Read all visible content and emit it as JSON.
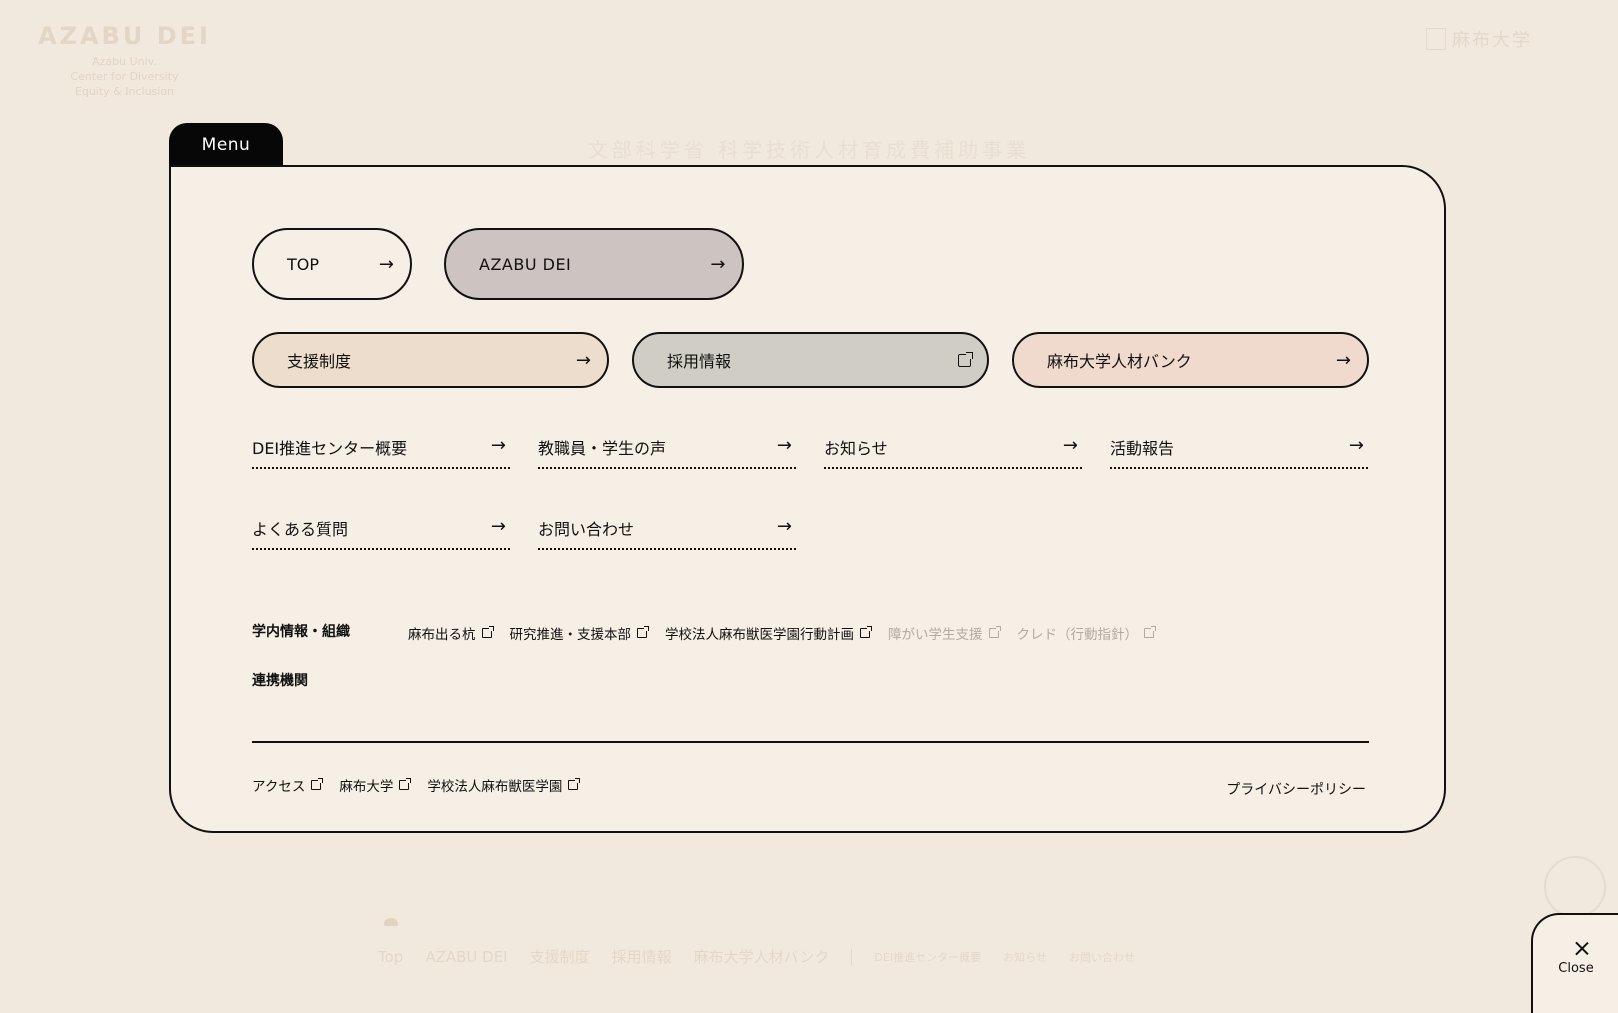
{
  "background": {
    "logo_mark": "AZABU DEI",
    "logo_sub_lines": [
      "Azabu Univ.",
      "Center for Diversity",
      "Equity & Inclusion"
    ],
    "university": "麻布大学",
    "heading": "文部科学省 科学技術人材育成費補助事業",
    "footer_items": [
      "Top",
      "AZABU DEI",
      "支援制度",
      "採用情報",
      "麻布大学人材バンク"
    ],
    "footer_small_items": [
      "DEI推進センター概要",
      "お知らせ",
      "お問い合わせ"
    ]
  },
  "menu": {
    "tab_label": "Menu",
    "primary": [
      {
        "label": "TOP",
        "icon": "arrow-right-icon"
      },
      {
        "label": "AZABU DEI",
        "icon": "arrow-right-icon"
      }
    ],
    "secondary": [
      {
        "label": "支援制度",
        "icon": "arrow-right-icon"
      },
      {
        "label": "採用情報",
        "icon": "external-link-icon"
      },
      {
        "label": "麻布大学人材バンク",
        "icon": "arrow-right-icon"
      }
    ],
    "links": [
      {
        "label": "DEI推進センター概要"
      },
      {
        "label": "教職員・学生の声"
      },
      {
        "label": "お知らせ"
      },
      {
        "label": "活動報告"
      },
      {
        "label": "よくある質問"
      },
      {
        "label": "お問い合わせ"
      }
    ],
    "arrow": "→",
    "info_label": "学内情報・組織",
    "info_links": [
      {
        "label": "麻布出る杭",
        "dim": false
      },
      {
        "label": "研究推進・支援本部",
        "dim": false
      },
      {
        "label": "学校法人麻布獣医学園行動計画",
        "dim": false
      },
      {
        "label": "障がい学生支援",
        "dim": true
      },
      {
        "label": "クレド（行動指針）",
        "dim": true
      }
    ],
    "partners_label": "連携機関",
    "footer_links": [
      {
        "label": "アクセス"
      },
      {
        "label": "麻布大学"
      },
      {
        "label": "学校法人麻布獣医学園"
      }
    ],
    "privacy": "プライバシーポリシー"
  },
  "close": {
    "label": "Close"
  },
  "colors": {
    "page_bg": "#f2e9de",
    "panel_bg": "#f6efe5",
    "dei_pill": "#cdc3c1",
    "support_pill": "#ecddcc",
    "recruit_pill": "#cfcdc4",
    "bank_pill": "#f0dace",
    "ink": "#111111"
  }
}
